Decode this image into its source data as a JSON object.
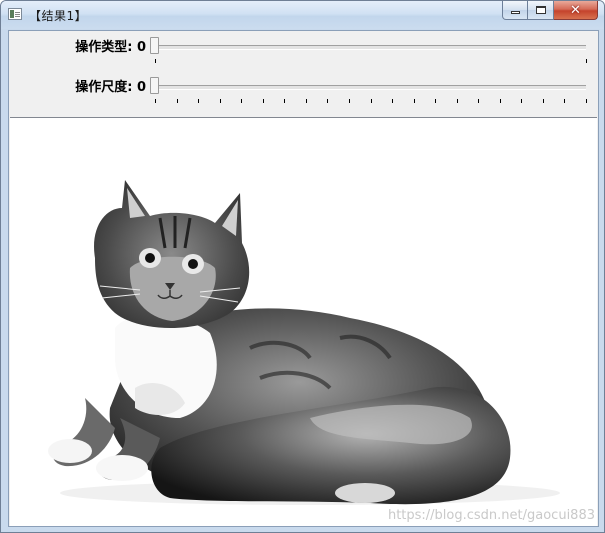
{
  "window": {
    "title": "【结果1】",
    "icon": "app-window-icon",
    "controls": [
      "minimize-icon",
      "maximize-icon",
      "close-icon"
    ],
    "close_color": "#c5432c"
  },
  "trackbars": [
    {
      "label": "操作类型: 0",
      "value": 0,
      "max": 1
    },
    {
      "label": "操作尺度: 0",
      "value": 0,
      "max": 20
    }
  ],
  "image": {
    "description_icon": "grayscale-cat-photo",
    "watermark": "https://blog.csdn.net/gaocui883"
  }
}
